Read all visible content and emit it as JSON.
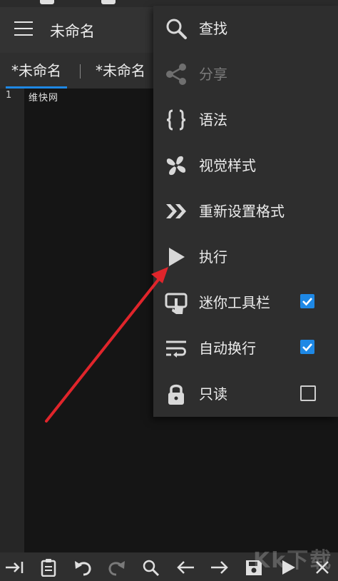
{
  "app": {
    "title": "未命名"
  },
  "tabs": [
    {
      "label": "*未命名",
      "active": true
    },
    {
      "label": "*未命名",
      "active": false
    }
  ],
  "editor": {
    "line_number": "1",
    "line_text": "维快网"
  },
  "menu": {
    "items": [
      {
        "label": "查找",
        "icon": "search-icon",
        "enabled": true
      },
      {
        "label": "分享",
        "icon": "share-icon",
        "enabled": false
      },
      {
        "label": "语法",
        "icon": "braces-icon",
        "enabled": true
      },
      {
        "label": "视觉样式",
        "icon": "fan-icon",
        "enabled": true
      },
      {
        "label": "重新设置格式",
        "icon": "double-chevron-icon",
        "enabled": true
      },
      {
        "label": "执行",
        "icon": "play-icon",
        "enabled": true
      },
      {
        "label": "迷你工具栏",
        "icon": "touch-toolbar-icon",
        "checked": true
      },
      {
        "label": "自动换行",
        "icon": "wrap-icon",
        "checked": true
      },
      {
        "label": "只读",
        "icon": "lock-icon",
        "checked": false
      }
    ]
  },
  "toolbar": {
    "buttons": [
      "tab-indent-icon",
      "clipboard-icon",
      "undo-icon",
      "redo-icon",
      "search-icon",
      "arrow-left-icon",
      "arrow-right-icon",
      "save-icon",
      "play-icon",
      "close-icon"
    ]
  },
  "watermark": {
    "text": "Kk下载"
  },
  "colors": {
    "accent": "#1e88e5",
    "annotation_arrow": "#e0252b",
    "menu_bg": "#2e2e2e",
    "appbar_bg": "#333333"
  }
}
